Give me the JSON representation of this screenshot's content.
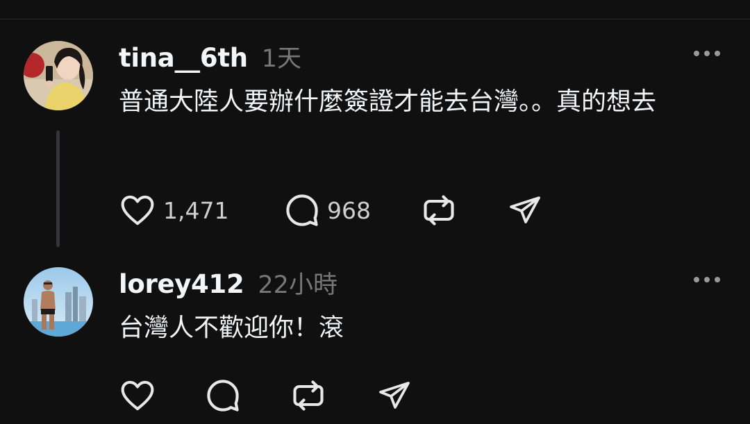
{
  "posts": [
    {
      "username": "tina__6th",
      "timestamp": "1天",
      "text": "普通大陸人要辦什麼簽證才能去台灣。。真的想去",
      "likes": "1,471",
      "replies": "968"
    },
    {
      "username": "lorey412",
      "timestamp": "22小時",
      "text": "台灣人不歡迎你！滾",
      "likes": "",
      "replies": ""
    }
  ],
  "icons": {
    "like": "heart-icon",
    "reply": "speech-bubble-icon",
    "repost": "repost-icon",
    "share": "paper-plane-icon",
    "more": "more-dots-icon"
  },
  "colors": {
    "background": "#101010",
    "text": "#f3f5f7",
    "muted": "#777777",
    "divider": "#262626"
  }
}
